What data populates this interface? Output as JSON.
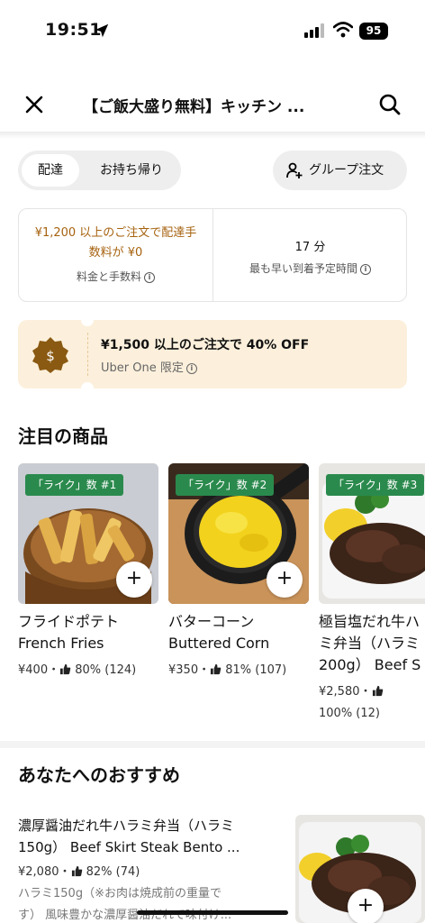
{
  "status_bar": {
    "time": "19:51",
    "battery": "95"
  },
  "header": {
    "title": "【ご飯大盛り無料】キッチン ..."
  },
  "modes": {
    "delivery": "配達",
    "pickup": "お持ち帰り"
  },
  "group_order": {
    "label": "グループ注文"
  },
  "info": {
    "fee_line1": "¥1,200 以上のご注文で配達手",
    "fee_line2": "数料が ¥0",
    "fee_label": "料金と手数料",
    "eta_value": "17 分",
    "eta_label": "最も早い到着予定時間"
  },
  "promo": {
    "title": "¥1,500 以上のご注文で 40% OFF",
    "subtitle": "Uber One 限定",
    "badge_symbol": "$"
  },
  "featured": {
    "title": "注目の商品",
    "items": [
      {
        "badge": "「ライク」数 #1",
        "name_line1": "フライドポテト",
        "name_line2": "French Fries",
        "meta_price": "¥400・",
        "meta_rating": "80% (124)",
        "meta_line2": ""
      },
      {
        "badge": "「ライク」数 #2",
        "name_line1": "バターコーン",
        "name_line2": "Buttered Corn",
        "meta_price": "¥350・",
        "meta_rating": "81% (107)",
        "meta_line2": ""
      },
      {
        "badge": "「ライク」数 #3",
        "name_line1": "極旨塩だれ牛ハ",
        "name_line2": "ミ弁当（ハラミ",
        "name_line3": "200g） Beef S",
        "meta_price": "¥2,580・",
        "meta_rating": "",
        "meta_line2": "100% (12)"
      }
    ]
  },
  "recommended": {
    "title": "あなたへのおすすめ",
    "item": {
      "name_line1": "濃厚醤油だれ牛ハラミ弁当（ハラミ",
      "name_line2": "150g） Beef Skirt Steak Bento ...",
      "meta_price": "¥2,080・",
      "meta_rating": "82% (74)",
      "desc_line1": "ハラミ150g（※お肉は焼成前の重量で",
      "desc_line2": "す） 風味豊かな濃厚醤油だれで味付け..."
    }
  },
  "add_symbol": "+",
  "colors": {
    "fee_text": "#a6620f",
    "promo_bg": "#fcf0dc",
    "badge_green": "#2a8a4d",
    "promo_badge": "#8a5a12"
  },
  "icons": [
    "location-arrow-icon",
    "signal-icon",
    "wifi-icon",
    "close-icon",
    "search-icon",
    "add-person-icon",
    "info-icon",
    "dollar-badge-icon",
    "thumbs-up-icon",
    "plus-icon"
  ]
}
